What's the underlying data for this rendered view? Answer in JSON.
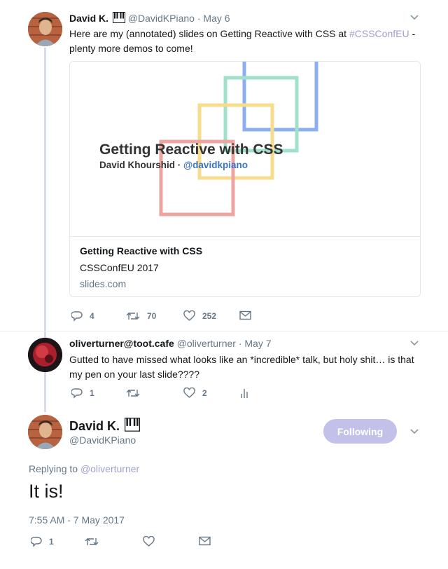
{
  "tweet1": {
    "name": "David K.",
    "handle": "@DavidKPiano",
    "separator": "·",
    "date": "May 6",
    "text_before": "Here are my (annotated) slides on Getting Reactive with CSS at ",
    "hashtag": "#CSSConfEU",
    "text_after": " - plenty more demos to come!",
    "card": {
      "slide_title": "Getting Reactive with CSS",
      "slide_author": "David Khourshid · ",
      "slide_twitter": "@davidkpiano",
      "title": "Getting Reactive with CSS",
      "description": "CSSConfEU 2017",
      "domain": "slides.com"
    },
    "actions": {
      "replies": "4",
      "retweets": "70",
      "likes": "252"
    }
  },
  "tweet2": {
    "name": "oliverturner@toot.cafe",
    "handle": "@oliverturner",
    "separator": "·",
    "date": "May 7",
    "text": "Gutted to have missed what looks like an *incredible* talk, but holy shit… is that my pen on your last slide????",
    "actions": {
      "replies": "1",
      "retweets": "",
      "likes": "2"
    }
  },
  "main_tweet": {
    "name": "David K.",
    "handle": "@DavidKPiano",
    "follow_label": "Following",
    "replying_prefix": "Replying to ",
    "replying_to": "@oliverturner",
    "text": "It is!",
    "timestamp": "7:55 AM - 7 May 2017",
    "actions": {
      "replies": "1",
      "retweets": "",
      "likes": ""
    }
  },
  "colors": {
    "accent": "#9f9fd0",
    "follow_button": "#c3c1ea",
    "muted_text": "#657786",
    "thread_line": "#d6dbe8"
  },
  "icons": [
    "reply-icon",
    "retweet-icon",
    "like-icon",
    "dm-icon",
    "analytics-icon",
    "chevron-down-icon",
    "piano-icon"
  ]
}
